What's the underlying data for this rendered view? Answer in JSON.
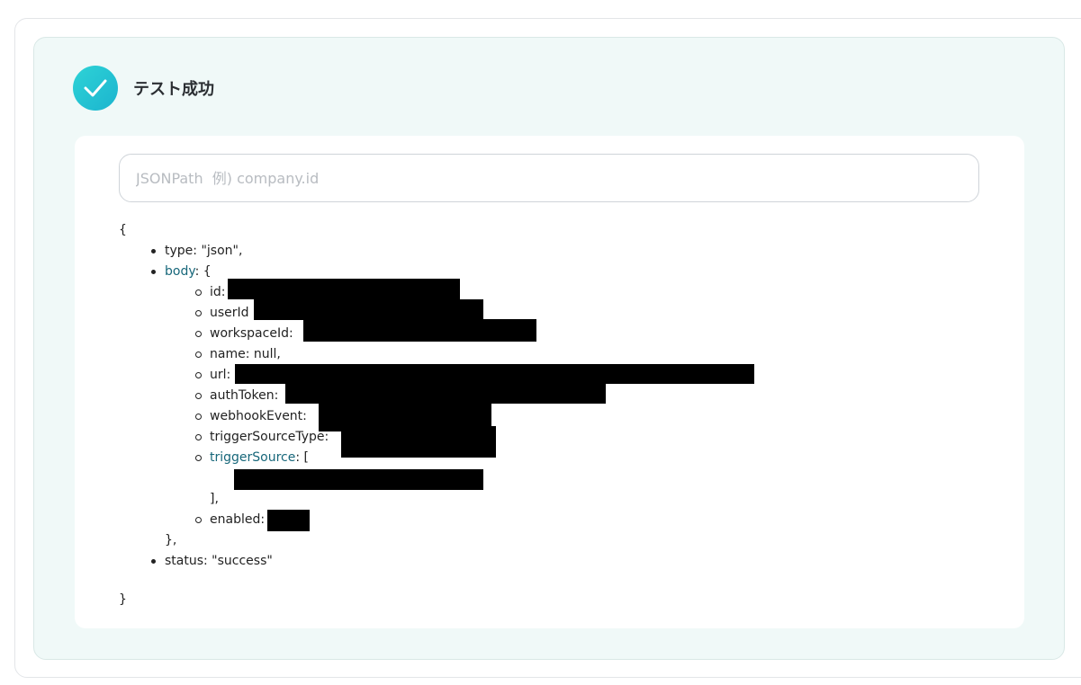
{
  "header": {
    "status_title": "テスト成功",
    "status_icon": "check-icon",
    "accent_color": "#22c3d3"
  },
  "search": {
    "placeholder": "JSONPath  例) company.id",
    "value": ""
  },
  "json_view": {
    "open_brace": "{",
    "close_brace": "}",
    "type_line": "type: \"json\",",
    "body_key": "body",
    "body_open": ": {",
    "body_fields": {
      "id": "id:",
      "user_id": "userId",
      "workspace_id": "workspaceId:",
      "name": "name: null,",
      "url": "url:",
      "auth_token": "authToken:",
      "webhook_event": "webhookEvent:",
      "trigger_source_type": "triggerSourceType:",
      "trigger_source_key": "triggerSource",
      "trigger_source_open": ": [",
      "trigger_source_close": "],",
      "enabled": "enabled:"
    },
    "body_close": "},",
    "status_line": "status: \"success\""
  }
}
